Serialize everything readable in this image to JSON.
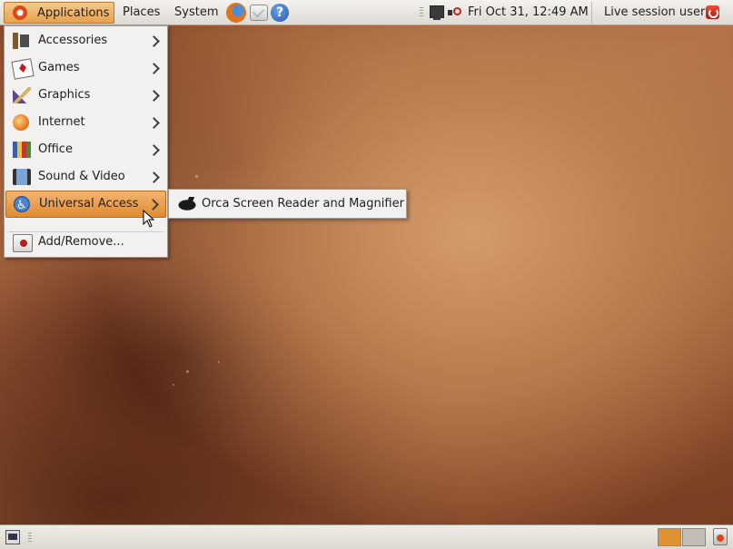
{
  "top_panel": {
    "menus": {
      "applications": "Applications",
      "places": "Places",
      "system": "System"
    },
    "launchers": [
      "firefox-icon",
      "mail-icon",
      "help-icon"
    ],
    "tray_icons": [
      "network-icon",
      "volume-muted-icon"
    ],
    "clock": "Fri Oct 31, 12:49 AM",
    "user_menu": "Live session user",
    "accent_color": "#e7a14f"
  },
  "applications_menu": {
    "items": [
      {
        "label": "Accessories",
        "icon": "accessories-icon",
        "has_submenu": true
      },
      {
        "label": "Games",
        "icon": "games-icon",
        "has_submenu": true
      },
      {
        "label": "Graphics",
        "icon": "graphics-icon",
        "has_submenu": true
      },
      {
        "label": "Internet",
        "icon": "internet-icon",
        "has_submenu": true
      },
      {
        "label": "Office",
        "icon": "office-icon",
        "has_submenu": true
      },
      {
        "label": "Sound & Video",
        "icon": "sound-video-icon",
        "has_submenu": true
      },
      {
        "label": "Universal Access",
        "icon": "universal-access-icon",
        "has_submenu": true,
        "active": true
      }
    ],
    "footer_item": {
      "label": "Add/Remove...",
      "icon": "add-remove-icon"
    }
  },
  "submenu": {
    "items": [
      {
        "label": "Orca Screen Reader and Magnifier",
        "icon": "orca-icon"
      }
    ]
  },
  "bottom_panel": {
    "workspaces": 2,
    "active_workspace": 1,
    "icons": [
      "show-desktop-icon",
      "trash-icon"
    ]
  }
}
